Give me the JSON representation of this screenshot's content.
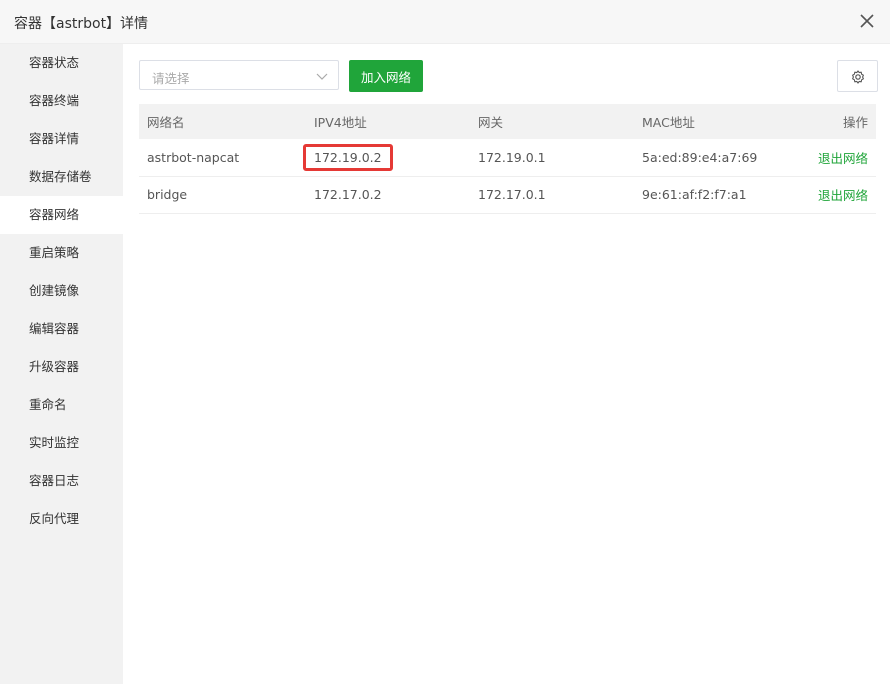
{
  "window": {
    "title": "容器【astrbot】详情"
  },
  "sidebar": {
    "items": [
      {
        "label": "容器状态"
      },
      {
        "label": "容器终端"
      },
      {
        "label": "容器详情"
      },
      {
        "label": "数据存储卷"
      },
      {
        "label": "容器网络"
      },
      {
        "label": "重启策略"
      },
      {
        "label": "创建镜像"
      },
      {
        "label": "编辑容器"
      },
      {
        "label": "升级容器"
      },
      {
        "label": "重命名"
      },
      {
        "label": "实时监控"
      },
      {
        "label": "容器日志"
      },
      {
        "label": "反向代理"
      }
    ],
    "active": "容器网络"
  },
  "toolbar": {
    "select_placeholder": "请选择",
    "join_label": "加入网络"
  },
  "table": {
    "headers": [
      "网络名",
      "IPV4地址",
      "网关",
      "MAC地址",
      "操作"
    ],
    "rows": [
      {
        "name": "astrbot-napcat",
        "ipv4": "172.19.0.2",
        "gateway": "172.19.0.1",
        "mac": "5a:ed:89:e4:a7:69",
        "action": "退出网络",
        "highlighted": true
      },
      {
        "name": "bridge",
        "ipv4": "172.17.0.2",
        "gateway": "172.17.0.1",
        "mac": "9e:61:af:f2:f7:a1",
        "action": "退出网络",
        "highlighted": false
      }
    ]
  },
  "colors": {
    "accent": "#20a53a",
    "highlight": "#e53935"
  },
  "icons": {
    "close": "close-icon",
    "chevron": "chevron-down-icon",
    "settings": "gear-icon"
  }
}
